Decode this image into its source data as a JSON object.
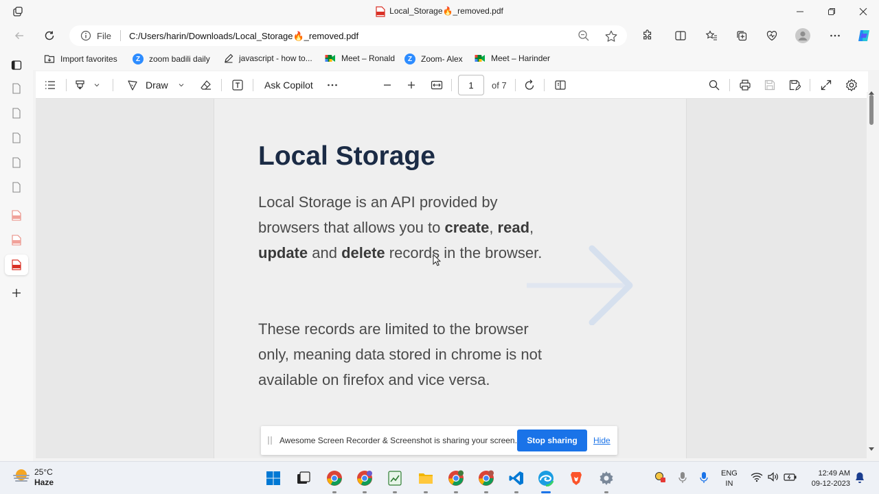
{
  "window": {
    "title": "Local_Storage🔥_removed.pdf"
  },
  "address": {
    "scheme": "File",
    "url": "C:/Users/harin/Downloads/Local_Storage🔥_removed.pdf"
  },
  "favorites": [
    {
      "label": "Import favorites",
      "icon": "import-icon"
    },
    {
      "label": "zoom badili daily",
      "icon": "zoom-icon"
    },
    {
      "label": "javascript - how to...",
      "icon": "pen-icon"
    },
    {
      "label": "Meet – Ronald",
      "icon": "meet-icon"
    },
    {
      "label": "Zoom- Alex",
      "icon": "zoom-icon"
    },
    {
      "label": "Meet – Harinder",
      "icon": "meet-icon"
    }
  ],
  "pdf_toolbar": {
    "draw_label": "Draw",
    "copilot_label": "Ask Copilot",
    "page_current": "1",
    "page_total": "of 7"
  },
  "document": {
    "title": "Local Storage",
    "para1": {
      "t1": "Local Storage is an API provided by browsers that allows you to ",
      "b1": "create",
      "t2": ", ",
      "b2": "read",
      "t3": ", ",
      "b3": "update",
      "t4": " and ",
      "b4": "delete",
      "t5": " records in the browser."
    },
    "para2": "These records are limited to the browser only, meaning data stored in chrome is not available on firefox and vice versa."
  },
  "sharing": {
    "message": "Awesome Screen Recorder & Screenshot is sharing your screen.",
    "stop_label": "Stop sharing",
    "hide_label": "Hide"
  },
  "taskbar": {
    "temperature": "25°C",
    "condition": "Haze",
    "lang_top": "ENG",
    "lang_bottom": "IN",
    "time": "12:49 AM",
    "date": "09-12-2023"
  },
  "colors": {
    "accent": "#1a73e8",
    "doc_title": "#1b2b45",
    "pdf_red": "#d93025"
  }
}
